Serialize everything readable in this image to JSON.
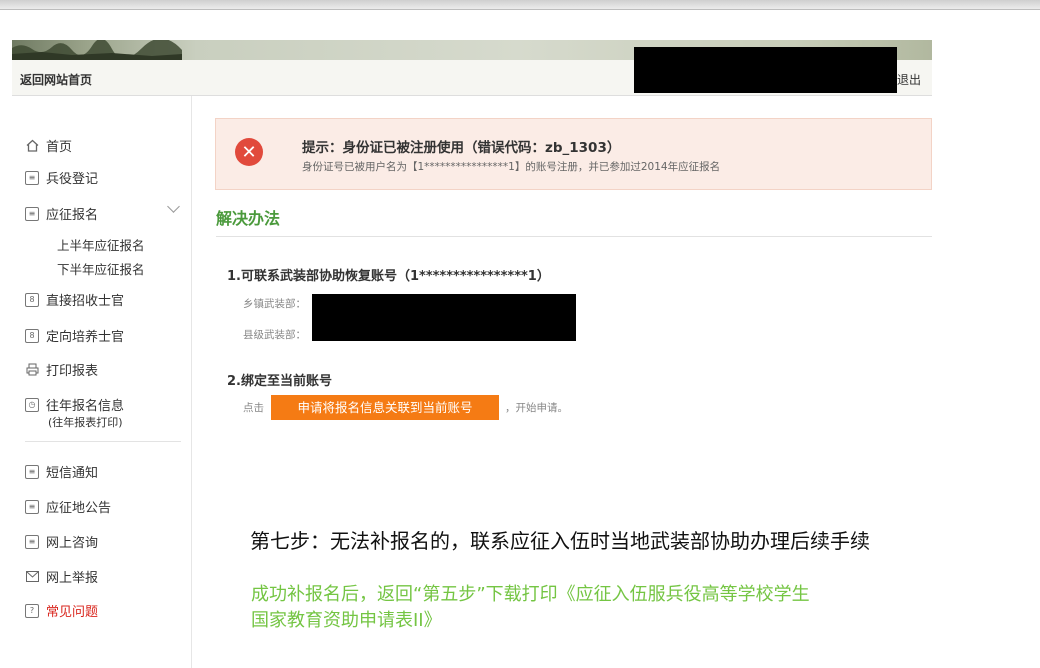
{
  "header": {
    "home_link": "返回网站首页",
    "logout": "退出"
  },
  "sidebar": {
    "items": [
      {
        "label": "首页",
        "icon": "home-icon"
      },
      {
        "label": "兵役登记",
        "icon": "register-icon"
      },
      {
        "label": "应征报名",
        "icon": "form-icon"
      },
      {
        "label": "直接招收士官",
        "icon": "id-card-icon"
      },
      {
        "label": "定向培养士官",
        "icon": "id-card-icon"
      },
      {
        "label": "打印报表",
        "icon": "printer-icon"
      },
      {
        "label": "往年报名信息",
        "icon": "history-icon",
        "note": "(往年报表打印)"
      },
      {
        "label": "短信通知",
        "icon": "message-icon"
      },
      {
        "label": "应征地公告",
        "icon": "notice-icon"
      },
      {
        "label": "网上咨询",
        "icon": "chat-icon"
      },
      {
        "label": "网上举报",
        "icon": "mail-icon"
      },
      {
        "label": "常见问题",
        "icon": "question-icon"
      }
    ],
    "subitems": [
      "上半年应征报名",
      "下半年应征报名"
    ]
  },
  "alert": {
    "title": "提示：身份证已被注册使用（错误代码：zb_1303）",
    "desc": "身份证号已被用户名为【1****************1】的账号注册，并已参加过2014年应征报名",
    "color": "#e14a3c"
  },
  "solution": {
    "title": "解决办法",
    "step1": "1.可联系武装部协助恢复账号（1****************1）",
    "town_label": "乡镇武装部：",
    "county_label": "县级武装部：",
    "step2": "2.绑定至当前账号",
    "click_label": "点击",
    "apply_button": "申请将报名信息关联到当前账号",
    "after_label": "，开始申请。"
  },
  "annotation": {
    "step7": "第七步：无法补报名的，联系应征入伍时当地武装部协助办理后续手续",
    "line1": "成功补报名后，返回“第五步”下载打印《应征入伍服兵役高等学校学生",
    "line2": "国家教育资助申请表II》",
    "green": "#74c543"
  },
  "colors": {
    "accent_orange": "#f57b14",
    "title_green": "#4b9a3c",
    "faq_red": "#d9251d"
  }
}
